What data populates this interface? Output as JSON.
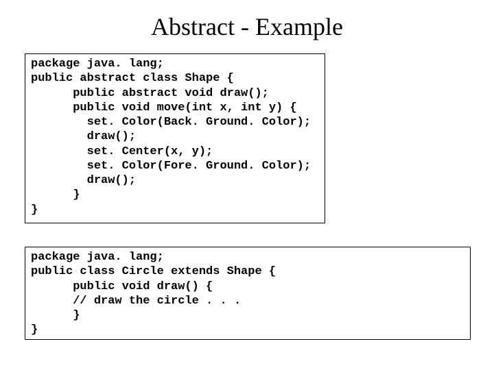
{
  "title": "Abstract - Example",
  "code1": "package java. lang;\npublic abstract class Shape {\n      public abstract void draw();\n      public void move(int x, int y) {\n        set. Color(Back. Ground. Color);\n        draw();\n        set. Center(x, y);\n        set. Color(Fore. Ground. Color);\n        draw();\n      }\n}",
  "code2": "package java. lang;\npublic class Circle extends Shape {\n      public void draw() {\n      // draw the circle . . .\n      }\n}"
}
